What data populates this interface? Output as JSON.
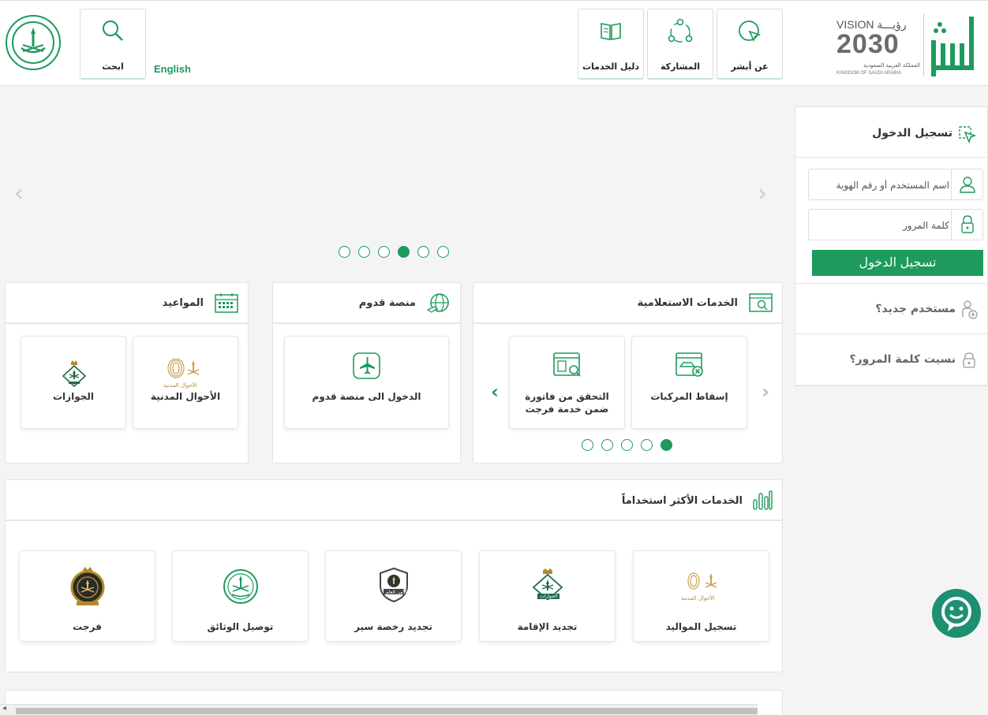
{
  "header": {
    "english": "English",
    "search_label": "ابحث",
    "nav": [
      {
        "label": "عن أبشر"
      },
      {
        "label": "المشاركة"
      },
      {
        "label": "دليل الخدمات"
      }
    ],
    "vision": {
      "line1": "VISION رؤيـــة",
      "line2": "2030",
      "line3": "المملكة العربية السعودية",
      "line4": "KINGDOM OF SAUDI ARABIA"
    }
  },
  "slider": {
    "dots": 6,
    "active_dot": 4
  },
  "inquiry": {
    "title": "الخدمات الاستعلامية",
    "cards": [
      {
        "label": "إسقاط المركبات"
      },
      {
        "label": "التحقق من فاتورة ضمن خدمة فرجت"
      }
    ],
    "dots": 5,
    "active_dot": 1
  },
  "qudoom": {
    "title": "منصة قدوم",
    "cards": [
      {
        "label": "الدخول الى منصة قدوم"
      }
    ]
  },
  "appointments": {
    "title": "المواعيد",
    "cards": [
      {
        "label": "الأحوال المدنية",
        "logo_text": "الأحوال المدنية"
      },
      {
        "label": "الجوازات"
      }
    ]
  },
  "most_used": {
    "title": "الخدمات الأكثر استخداماً",
    "cards": [
      {
        "label": "تسجيل المواليد",
        "logo_text": "الأحوال المدنية"
      },
      {
        "label": "تجديد الإقامة",
        "logo_text": "الجوازات"
      },
      {
        "label": "تجديد رخصة سير",
        "logo_text": "الأمن العام"
      },
      {
        "label": "توصيل الوثائق"
      },
      {
        "label": "فرجت"
      }
    ]
  },
  "login": {
    "title": "تسجيل الدخول",
    "username_placeholder": "اسم المستخدم أو رقم الهوية",
    "password_placeholder": "كلمة المرور",
    "button": "تسجيل الدخول",
    "new_user": "مستخدم جديد؟",
    "forgot": "نسيت كلمة المرور؟"
  },
  "colors": {
    "accent": "#1d9a5c",
    "chat": "#1f8f73"
  }
}
